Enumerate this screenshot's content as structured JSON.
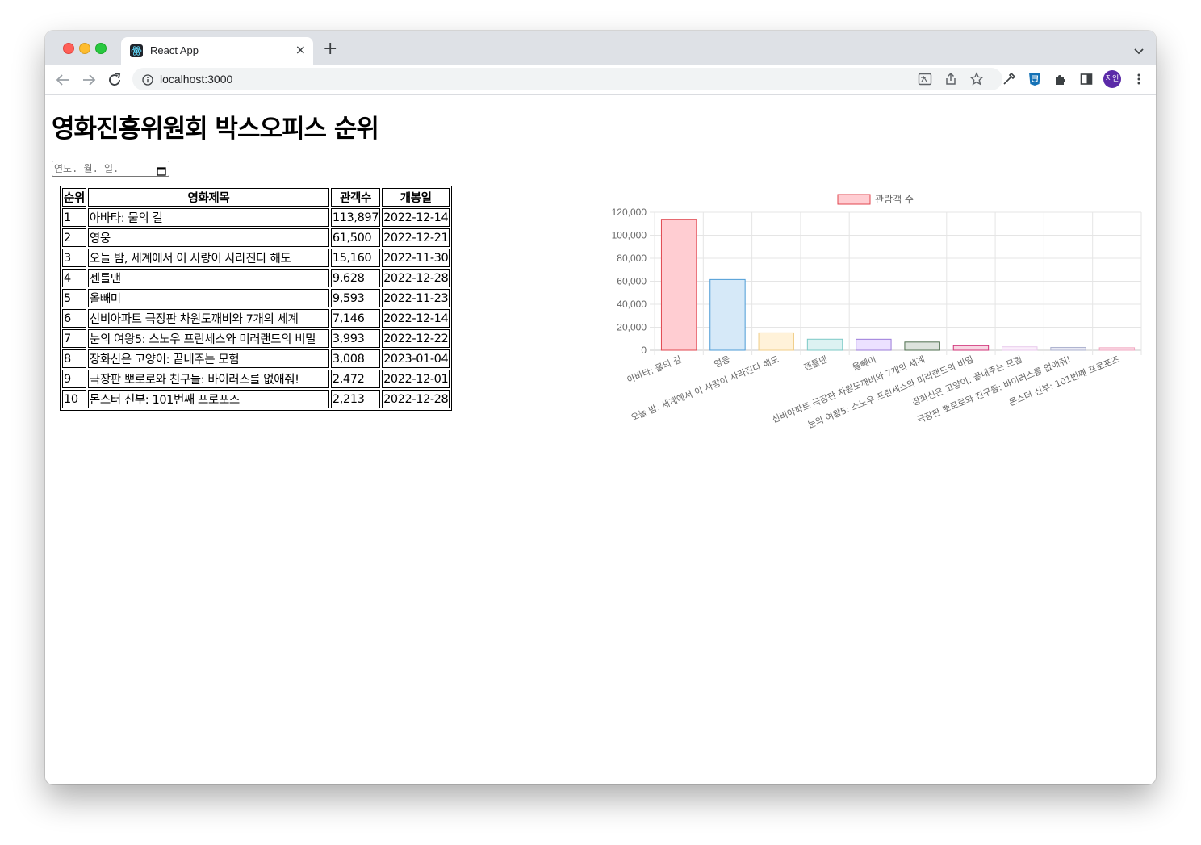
{
  "browser": {
    "tab_title": "React App",
    "tab_close": "×",
    "new_tab": "+",
    "url": "localhost:3000",
    "profile_initials": "지인"
  },
  "page": {
    "title": "영화진흥위원회 박스오피스 순위",
    "date_input_placeholder": "연도. 월. 일."
  },
  "table": {
    "headers": [
      "순위",
      "영화제목",
      "관객수",
      "개봉일"
    ],
    "rows": [
      {
        "rank": "1",
        "title": "아바타: 물의 길",
        "audience": "113,897",
        "open_date": "2022-12-14"
      },
      {
        "rank": "2",
        "title": "영웅",
        "audience": "61,500",
        "open_date": "2022-12-21"
      },
      {
        "rank": "3",
        "title": "오늘 밤, 세계에서 이 사랑이 사라진다 해도",
        "audience": "15,160",
        "open_date": "2022-11-30"
      },
      {
        "rank": "4",
        "title": "젠틀맨",
        "audience": "9,628",
        "open_date": "2022-12-28"
      },
      {
        "rank": "5",
        "title": "올빼미",
        "audience": "9,593",
        "open_date": "2022-11-23"
      },
      {
        "rank": "6",
        "title": "신비아파트 극장판 차원도깨비와 7개의 세계",
        "audience": "7,146",
        "open_date": "2022-12-14"
      },
      {
        "rank": "7",
        "title": "눈의 여왕5: 스노우 프린세스와 미러랜드의 비밀",
        "audience": "3,993",
        "open_date": "2022-12-22"
      },
      {
        "rank": "8",
        "title": "장화신은 고양이: 끝내주는 모험",
        "audience": "3,008",
        "open_date": "2023-01-04"
      },
      {
        "rank": "9",
        "title": "극장판 뽀로로와 친구들: 바이러스를 없애줘!",
        "audience": "2,472",
        "open_date": "2022-12-01"
      },
      {
        "rank": "10",
        "title": "몬스터 신부: 101번째 프로포즈",
        "audience": "2,213",
        "open_date": "2022-12-28"
      }
    ]
  },
  "chart_data": {
    "type": "bar",
    "categories": [
      "아바타: 물의 길",
      "영웅",
      "오늘 밤, 세계에서 이 사랑이 사라진다 해도",
      "젠틀맨",
      "올빼미",
      "신비아파트 극장판 차원도깨비와 7개의 세계",
      "눈의 여왕5: 스노우 프린세스와 미러랜드의 비밀",
      "장화신은 고양이: 끝내주는 모험",
      "극장판 뽀로로와 친구들: 바이러스를 없애줘!",
      "몬스터 신부: 101번째 프로포즈"
    ],
    "series": [
      {
        "name": "관람객 수",
        "values": [
          113897,
          61500,
          15160,
          9628,
          9593,
          7146,
          3993,
          3008,
          2472,
          2213
        ]
      }
    ],
    "ylim": [
      0,
      120000
    ],
    "yticks": [
      0,
      20000,
      40000,
      60000,
      80000,
      100000,
      120000
    ],
    "ytick_labels": [
      "0",
      "20,000",
      "40,000",
      "60,000",
      "80,000",
      "100,000",
      "120,000"
    ],
    "grid": true,
    "legend_position": "top",
    "bar_fill_colors": [
      "#ffcdd2",
      "#d6e9f8",
      "#fff2d9",
      "#dcf2f2",
      "#ece1ff",
      "#dde3dd",
      "#f8d6e3",
      "#fbf0fb",
      "#e9e9f4",
      "#fbe3ec"
    ],
    "bar_border_colors": [
      "#e0464f",
      "#4c9bd6",
      "#f0cd87",
      "#7cc9c6",
      "#9b7cd9",
      "#4f6f4f",
      "#d0357a",
      "#e8c9ec",
      "#aeb3cf",
      "#f2a7c1"
    ]
  }
}
